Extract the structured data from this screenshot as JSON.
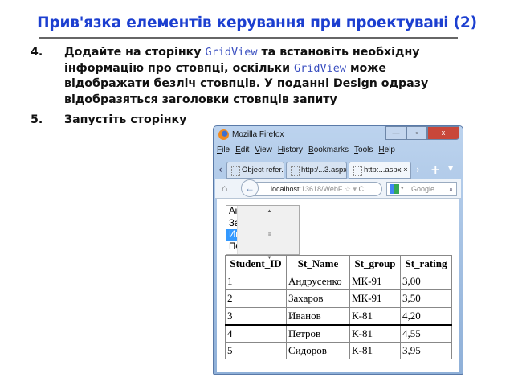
{
  "slide": {
    "title": "Прив'язка елементів керування при проектувані (2)",
    "items": [
      {
        "num": "4.",
        "parts": [
          "Додайте на сторінку ",
          "GridView",
          " та встановіть необхідну інформацію про стовпці, оскільки ",
          "GridView",
          " може відображати безліч стовпців. У поданні Design одразу відобразяться заголовки стовпців запиту"
        ]
      },
      {
        "num": "5.",
        "text": "Запустіть сторінку"
      }
    ]
  },
  "browser": {
    "title": "Mozilla Firefox",
    "window_buttons": [
      "—",
      "▫",
      "x"
    ],
    "menu": [
      "File",
      "Edit",
      "View",
      "History",
      "Bookmarks",
      "Tools",
      "Help"
    ],
    "tabs": [
      "Object refer...",
      "http:/...3.aspx",
      "http:...aspx"
    ],
    "tab_close": "×",
    "new_tab": "+",
    "url_host": "localhost",
    "url_rest": ":13618/WebF",
    "search_placeholder": "Google",
    "listbox": {
      "options": [
        "Андрусенко",
        "Захаров",
        "Иванов",
        "Петров"
      ],
      "selected": "Иванов"
    },
    "grid": {
      "columns": [
        "Student_ID",
        "St_Name",
        "St_group",
        "St_rating"
      ],
      "rows": [
        [
          "1",
          "Андрусенко",
          "МК-91",
          "3,00"
        ],
        [
          "2",
          "Захаров",
          "МК-91",
          "3,50"
        ],
        [
          "3",
          "Иванов",
          "К-81",
          "4,20"
        ],
        [
          "4",
          "Петров",
          "К-81",
          "4,55"
        ],
        [
          "5",
          "Сидоров",
          "К-81",
          "3,95"
        ]
      ]
    }
  }
}
